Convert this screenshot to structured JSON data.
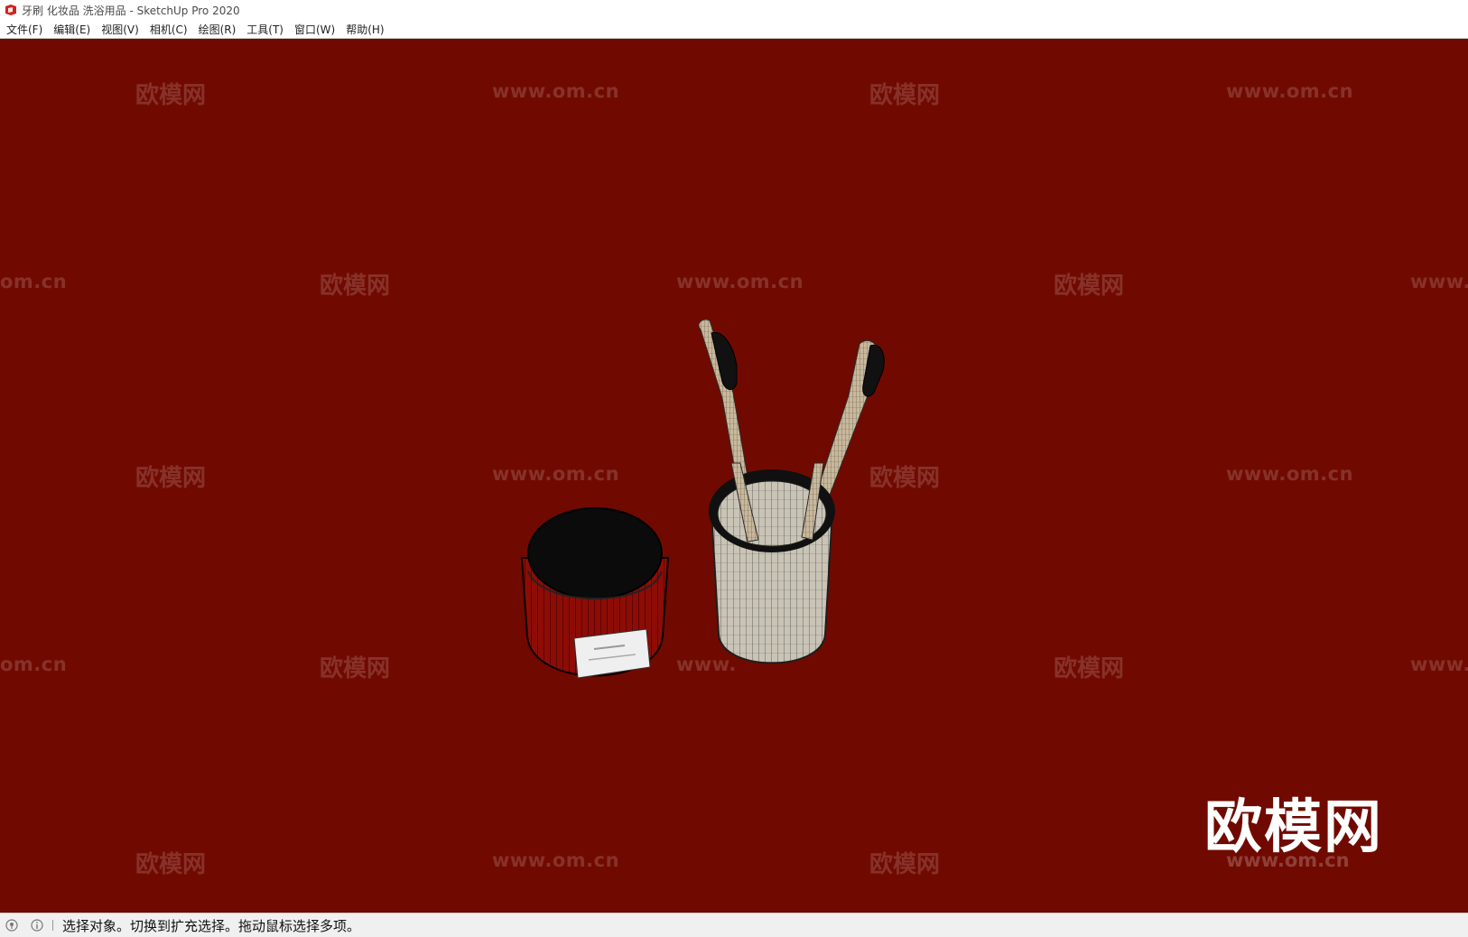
{
  "window": {
    "title": "牙刷 化妆品 洗浴用品 - SketchUp Pro 2020"
  },
  "menu": {
    "items": [
      {
        "label": "文件(F)"
      },
      {
        "label": "编辑(E)"
      },
      {
        "label": "视图(V)"
      },
      {
        "label": "相机(C)"
      },
      {
        "label": "绘图(R)"
      },
      {
        "label": "工具(T)"
      },
      {
        "label": "窗口(W)"
      },
      {
        "label": "帮助(H)"
      }
    ]
  },
  "viewport": {
    "background_color": "#700a00",
    "watermark_text": "欧模网",
    "watermark_url": "www.om.cn",
    "watermark_url_partial_left": "om.cn",
    "watermark_url_partial_right": "www.",
    "big_logo_text": "欧模网",
    "big_logo_url": "www.om.cn"
  },
  "status": {
    "text": "选择对象。切换到扩充选择。拖动鼠标选择多项。",
    "icons": [
      "geo-location-icon",
      "info-icon"
    ]
  }
}
